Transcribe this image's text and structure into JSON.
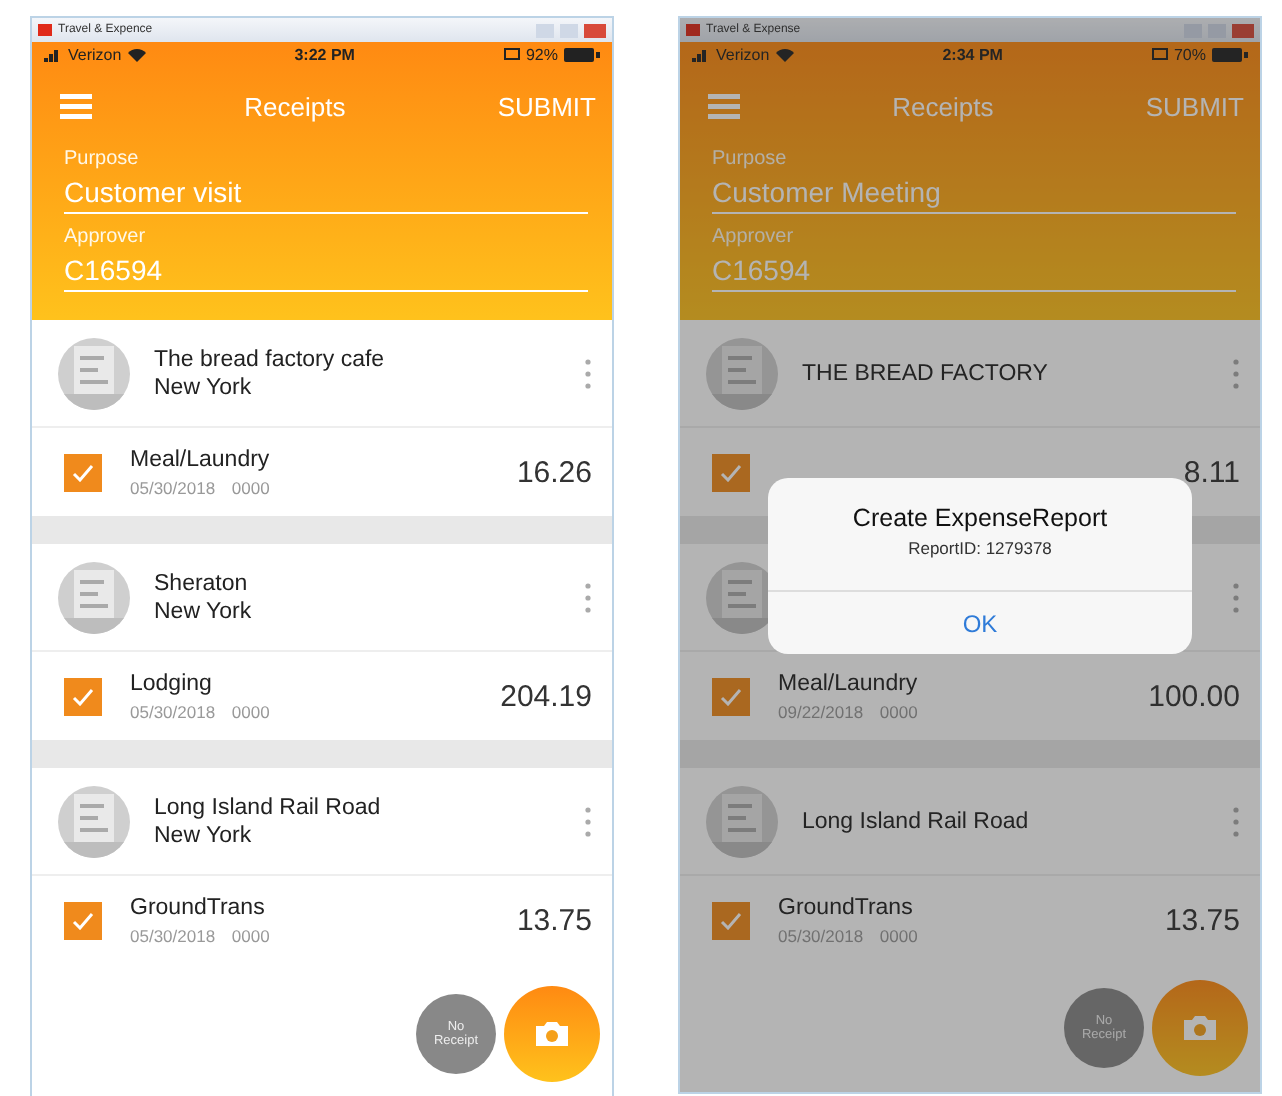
{
  "phones": [
    {
      "window_title": "Travel & Expence",
      "dimmed": false,
      "status": {
        "carrier": "Verizon",
        "time": "3:22 PM",
        "battery": "92%"
      },
      "nav": {
        "title": "Receipts",
        "action": "SUBMIT"
      },
      "fields": [
        {
          "label": "Purpose",
          "value": "Customer visit"
        },
        {
          "label": "Approver",
          "value": "C16594"
        }
      ],
      "groups": [
        {
          "merchant": {
            "name": "The bread factory cafe",
            "city": "New York"
          },
          "expense": {
            "category": "Meal/Laundry",
            "date": "05/30/2018",
            "code": "0000",
            "amount": "16.26",
            "checked": true
          }
        },
        {
          "merchant": {
            "name": "Sheraton",
            "city": "New York"
          },
          "expense": {
            "category": "Lodging",
            "date": "05/30/2018",
            "code": "0000",
            "amount": "204.19",
            "checked": true
          }
        },
        {
          "merchant": {
            "name": "Long Island Rail Road",
            "city": "New York"
          },
          "expense": {
            "category": "GroundTrans",
            "date": "05/30/2018",
            "code": "0000",
            "amount": "13.75",
            "checked": true
          }
        }
      ],
      "no_receipt": "No Receipt"
    },
    {
      "window_title": "Travel & Expense",
      "dimmed": true,
      "status": {
        "carrier": "Verizon",
        "time": "2:34 PM",
        "battery": "70%"
      },
      "nav": {
        "title": "Receipts",
        "action": "SUBMIT"
      },
      "fields": [
        {
          "label": "Purpose",
          "value": "Customer Meeting"
        },
        {
          "label": "Approver",
          "value": "C16594"
        }
      ],
      "groups": [
        {
          "merchant": {
            "name": "THE BREAD FACTORY"
          },
          "expense": {
            "amount": "8.11",
            "checked": true
          }
        },
        {
          "expense": {
            "category": "Meal/Laundry",
            "date": "09/22/2018",
            "code": "0000",
            "amount": "100.00",
            "checked": true
          }
        },
        {
          "merchant": {
            "name": "Long Island Rail Road"
          },
          "expense": {
            "category": "GroundTrans",
            "date": "05/30/2018",
            "code": "0000",
            "amount": "13.75",
            "checked": true
          }
        }
      ],
      "no_receipt": "No Receipt",
      "dialog": {
        "title": "Create ExpenseReport",
        "message": "ReportID: 1279378",
        "button": "OK"
      }
    }
  ]
}
